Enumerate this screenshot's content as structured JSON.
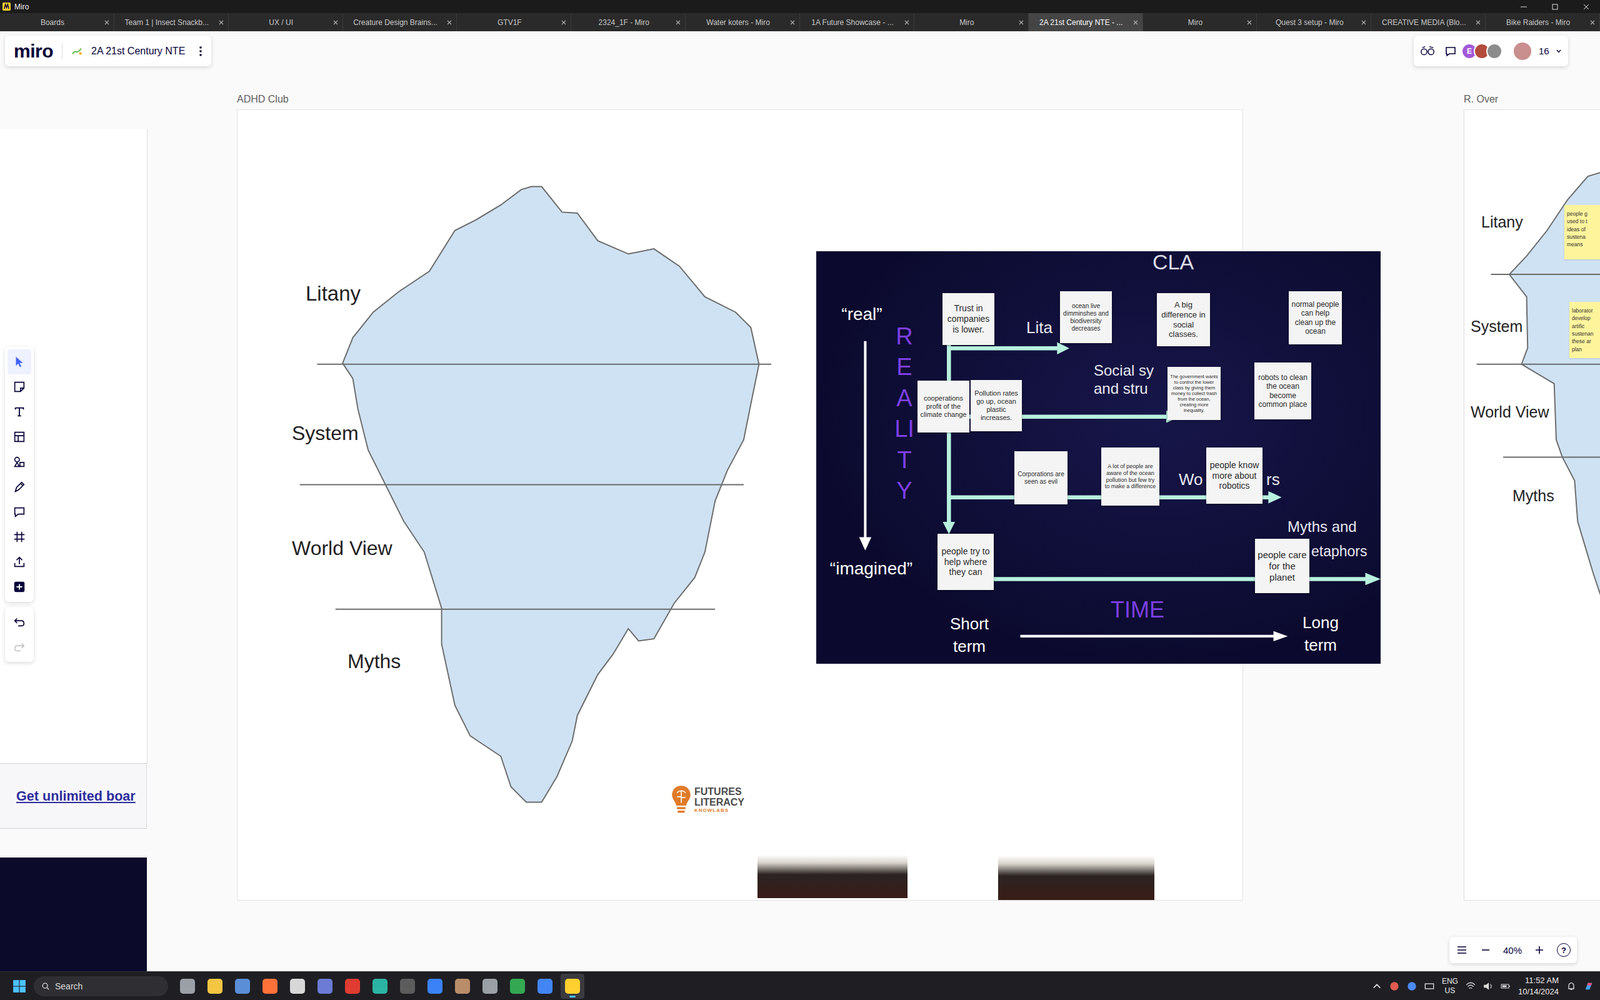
{
  "window": {
    "title": "Miro"
  },
  "tabs": [
    {
      "label": "Boards",
      "selected": false
    },
    {
      "label": "Team 1 | Insect Snackb...",
      "selected": false
    },
    {
      "label": "UX / UI",
      "selected": false
    },
    {
      "label": "Creature Design Brains...",
      "selected": false
    },
    {
      "label": "GTV1F",
      "selected": false
    },
    {
      "label": "2324_1F - Miro",
      "selected": false
    },
    {
      "label": "Water koters - Miro",
      "selected": false
    },
    {
      "label": "1A Future Showcase - ...",
      "selected": false
    },
    {
      "label": "Miro",
      "selected": false
    },
    {
      "label": "2A 21st Century NTE - ...",
      "selected": true
    },
    {
      "label": "Miro",
      "selected": false
    },
    {
      "label": "Quest 3 setup - Miro",
      "selected": false
    },
    {
      "label": "CREATIVE MEDIA (Blo...",
      "selected": false
    },
    {
      "label": "Bike Raiders - Miro",
      "selected": false
    }
  ],
  "board": {
    "logo": "miro",
    "name": "2A 21st Century NTE"
  },
  "collaborators": {
    "avatars": [
      {
        "kind": "initial",
        "initial": "E",
        "color": "#a259d9"
      },
      {
        "kind": "photo",
        "color": "#b44a3c"
      },
      {
        "kind": "photo",
        "color": "#8c8c8c"
      }
    ],
    "count_color": "#c98e8e",
    "count": "16"
  },
  "toolbar": {
    "tools": [
      {
        "kind": "select",
        "selected": true
      },
      {
        "kind": "sticky",
        "selected": false
      },
      {
        "kind": "text",
        "selected": false
      },
      {
        "kind": "templates",
        "selected": false
      },
      {
        "kind": "shapes",
        "selected": false
      },
      {
        "kind": "pen",
        "selected": false
      },
      {
        "kind": "comment",
        "selected": false
      },
      {
        "kind": "frame",
        "selected": false
      },
      {
        "kind": "upload",
        "selected": false
      },
      {
        "kind": "more",
        "selected": false
      }
    ],
    "history": [
      {
        "kind": "undo",
        "disabled": false
      },
      {
        "kind": "redo",
        "disabled": true
      }
    ]
  },
  "sidebar_panel": {
    "link": "Get unlimited boar"
  },
  "frames": [
    {
      "title": "ADHD Club",
      "layers": [
        "Litany",
        "System",
        "World View",
        "Myths"
      ]
    },
    {
      "title": "R. Over",
      "layers": [
        "Litany",
        "System",
        "World View",
        "Myths"
      ],
      "notes": [
        {
          "lines": [
            "people g",
            "used to t",
            "ideas of",
            "sustena",
            "means"
          ]
        },
        {
          "lines": [
            "laborator",
            "develop",
            "artific",
            "sustenan",
            "these ar",
            "plan"
          ]
        }
      ]
    }
  ],
  "cla": {
    "title": "CLA",
    "axis_top": "“real”",
    "axis_bottom": "“imagined”",
    "vertical_label": "REALITY",
    "layer_labels": [
      "Lita",
      "Social sy",
      "and stru",
      "Wo",
      "rs",
      "Myths and",
      "etaphors"
    ],
    "time_label": "TIME",
    "short": [
      "Short",
      "term"
    ],
    "long": [
      "Long",
      "term"
    ],
    "notes": [
      "Trust in companies is lower.",
      "ocean live dimminshes and biodiversity decreases",
      "A big difference in social classes.",
      "normal people can help clean up the ocean",
      "cooperations profit of the climate change",
      "Pollution rates go up, ocean plastic increases.",
      "The government wants to control the lower class by giving them money to collect trash from the ocean, creating more inequality.",
      "robots to clean the ocean become common place",
      "Corporations are seen as evil",
      "A lot of people are aware of the ocean pollution but few try to make a difference",
      "people know more about robotics",
      "people try to help where they can",
      "people care for the planet"
    ]
  },
  "logo": {
    "lines": [
      "FUTURES",
      "LITERACY",
      "KNOWLABS"
    ]
  },
  "zoom": {
    "level": "40%",
    "help": "?"
  },
  "taskbar": {
    "search": "Search",
    "apps": [
      {
        "active": false
      },
      {
        "active": false
      },
      {
        "active": false
      },
      {
        "active": false
      },
      {
        "active": false
      },
      {
        "active": false
      },
      {
        "active": false
      },
      {
        "active": false
      },
      {
        "active": false
      },
      {
        "active": false
      },
      {
        "active": false
      },
      {
        "active": false
      },
      {
        "active": false
      },
      {
        "active": false
      },
      {
        "active": true
      }
    ],
    "language": [
      "ENG",
      "US"
    ],
    "time": "11:52 AM",
    "date": "10/14/2024"
  }
}
